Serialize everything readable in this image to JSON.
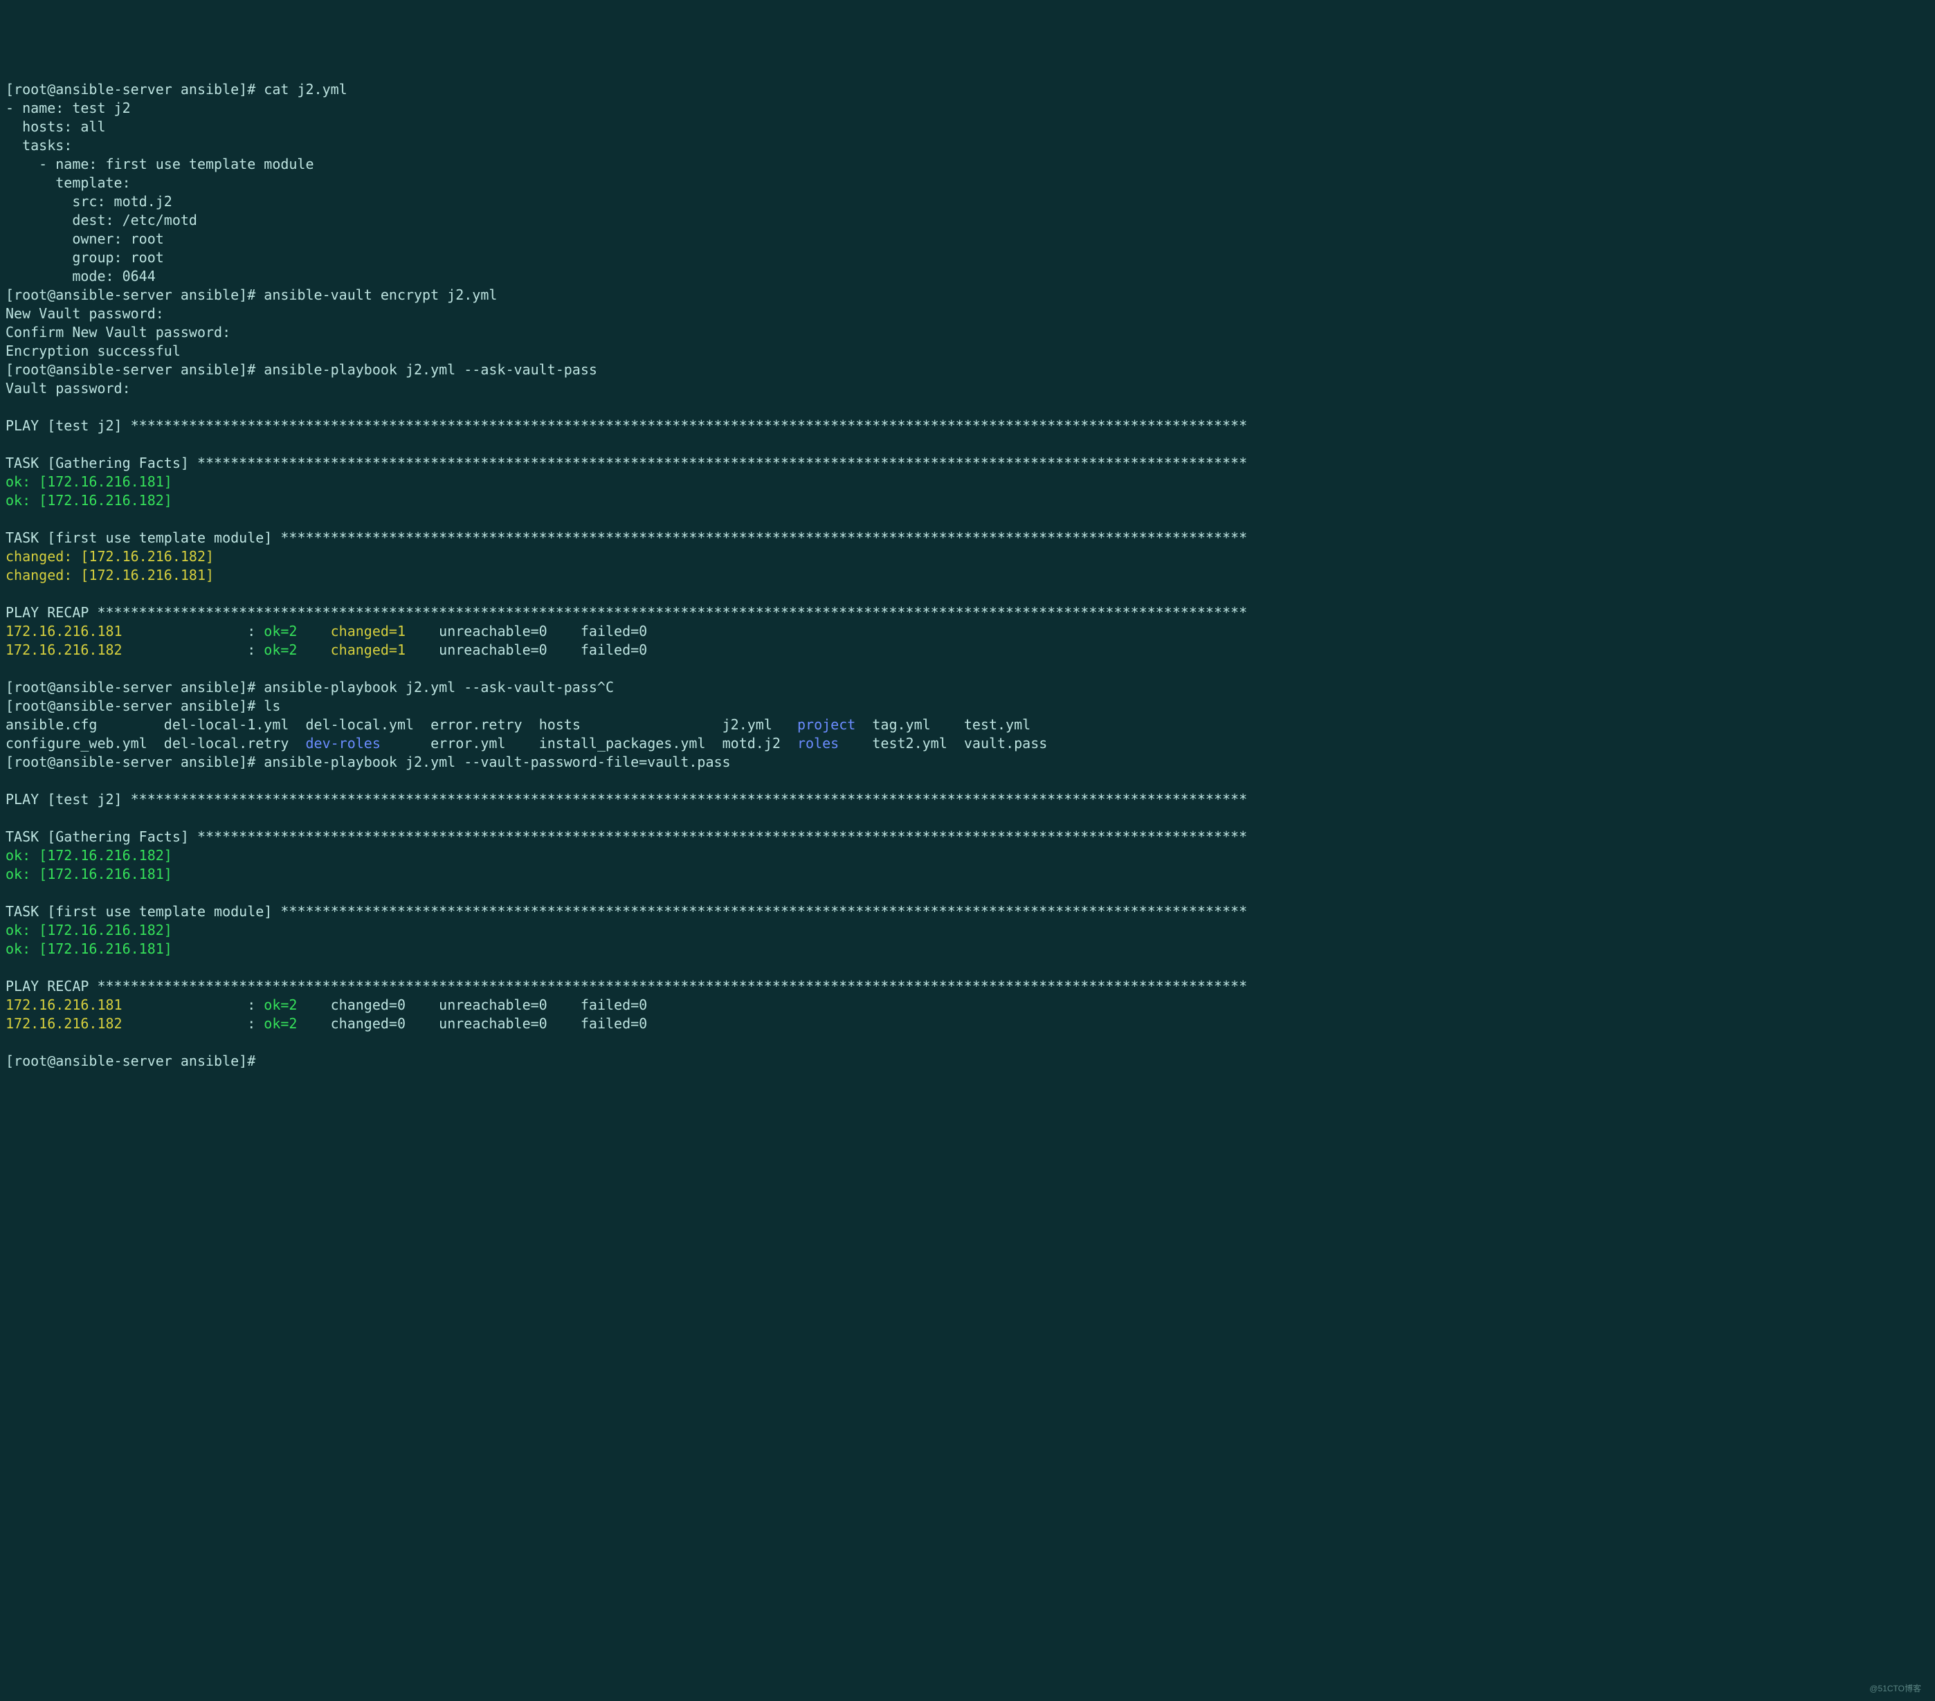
{
  "prompt": "[root@ansible-server ansible]#",
  "cmds": {
    "cat": "cat j2.yml",
    "encrypt": "ansible-vault encrypt j2.yml",
    "play_ask": "ansible-playbook j2.yml --ask-vault-pass",
    "play_ask_c": "ansible-playbook j2.yml --ask-vault-pass^C",
    "ls": "ls",
    "play_file": "ansible-playbook j2.yml --vault-password-file=vault.pass"
  },
  "yaml": {
    "l1": "- name: test j2",
    "l2": "  hosts: all",
    "l3": "  tasks:",
    "l4": "    - name: first use template module",
    "l5": "      template:",
    "l6": "        src: motd.j2",
    "l7": "        dest: /etc/motd",
    "l8": "        owner: root",
    "l9": "        group: root",
    "l10": "        mode: 0644"
  },
  "vault": {
    "newpw": "New Vault password:",
    "confirm": "Confirm New Vault password:",
    "success": "Encryption successful",
    "askpw": "Vault password:"
  },
  "play": {
    "header": "PLAY [test j2] ",
    "task_gather": "TASK [Gathering Facts] ",
    "task_tpl": "TASK [first use template module] ",
    "recap": "PLAY RECAP ",
    "ok181": "ok: [172.16.216.181]",
    "ok182": "ok: [172.16.216.182]",
    "chg181": "changed: [172.16.216.181]",
    "chg182": "changed: [172.16.216.182]"
  },
  "recap": {
    "host1": "172.16.216.181",
    "host2": "172.16.216.182",
    "sep": "               : ",
    "ok2": "ok=2",
    "sp1": "    ",
    "chg1": "changed=1",
    "chg0": "changed=0",
    "sp2": "    ",
    "unreach": "unreachable=0",
    "sp3": "    ",
    "failed": "failed=0"
  },
  "stars": {
    "play": "**************************************************************************************************************************************",
    "gather": "******************************************************************************************************************************",
    "tpl": "********************************************************************************************************************",
    "recap": "******************************************************************************************************************************************"
  },
  "ls": {
    "r1c1": "ansible.cfg",
    "pad_r1c1": "        ",
    "r1c2": "del-local-1.yml",
    "pad_r1c2": "  ",
    "r1c3": "del-local.yml",
    "pad_r1c3": "  ",
    "r1c4": "error.retry",
    "pad_r1c4": "  ",
    "r1c5": "hosts",
    "pad_r1c5": "                 ",
    "r1c6": "j2.yml",
    "pad_r1c6": "   ",
    "r1c7": "project",
    "pad_r1c7": "  ",
    "r1c8": "tag.yml",
    "pad_r1c8": "    ",
    "r1c9": "test.yml",
    "r2c1": "configure_web.yml",
    "pad_r2c1": "  ",
    "r2c2": "del-local.retry",
    "pad_r2c2": "  ",
    "r2c3": "dev-roles",
    "pad_r2c3": "      ",
    "r2c4": "error.yml",
    "pad_r2c4": "    ",
    "r2c5": "install_packages.yml",
    "pad_r2c5": "  ",
    "r2c6": "motd.j2",
    "pad_r2c6": "  ",
    "r2c7": "roles",
    "pad_r2c7": "    ",
    "r2c8": "test2.yml",
    "pad_r2c8": "  ",
    "r2c9": "vault.pass"
  },
  "watermark": "@51CTO博客"
}
